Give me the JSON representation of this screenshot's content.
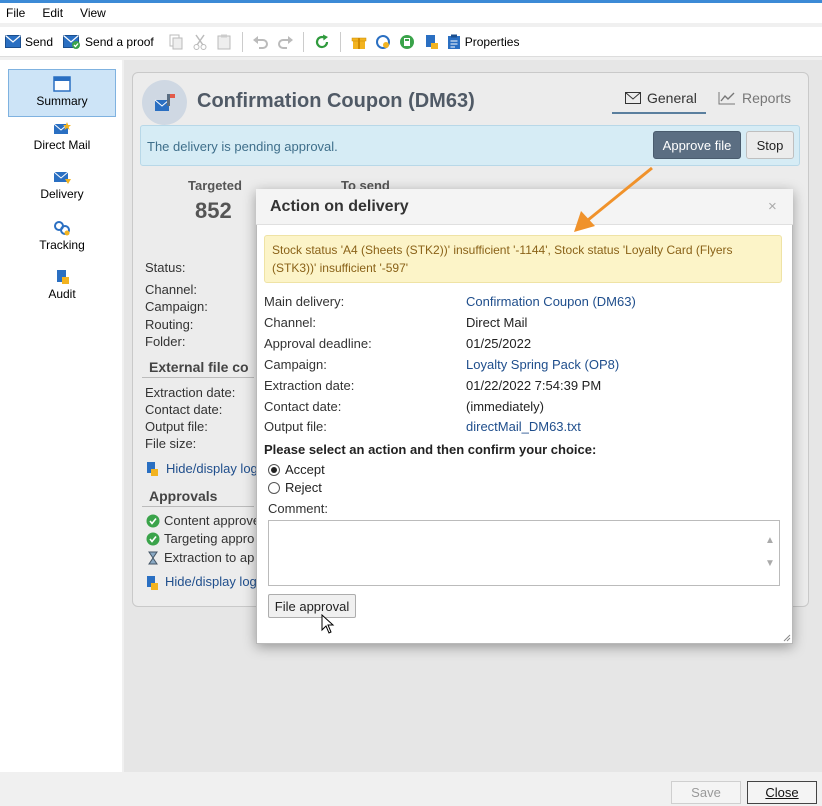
{
  "menu": {
    "items": [
      "File",
      "Edit",
      "View"
    ]
  },
  "toolbar": {
    "send_label": "Send",
    "send_proof_label": "Send a proof",
    "properties_label": "Properties"
  },
  "nav": {
    "items": [
      {
        "label": "Summary",
        "icon": "summary-icon"
      },
      {
        "label": "Direct Mail",
        "icon": "direct-mail-icon"
      },
      {
        "label": "Delivery",
        "icon": "delivery-icon"
      },
      {
        "label": "Tracking",
        "icon": "tracking-icon"
      },
      {
        "label": "Audit",
        "icon": "audit-icon"
      }
    ]
  },
  "header": {
    "title": "Confirmation Coupon (DM63)",
    "tabs": [
      {
        "label": "General"
      },
      {
        "label": "Reports"
      }
    ]
  },
  "status_bar": {
    "message": "The delivery is pending approval.",
    "approve_label": "Approve file",
    "stop_label": "Stop"
  },
  "stats": {
    "targeted_label": "Targeted",
    "targeted_value": "852",
    "to_send_label": "To send"
  },
  "summary": {
    "status_label": "Status:",
    "channel_label": "Channel:",
    "campaign_label": "Campaign:",
    "routing_label": "Routing:",
    "folder_label": "Folder:",
    "external_section": "External file co",
    "extraction_label": "Extraction date:",
    "contact_label": "Contact date:",
    "output_label": "Output file:",
    "filesize_label": "File size:",
    "hide_log_1": "Hide/display log",
    "approvals_section": "Approvals",
    "approvals": [
      "Content approve",
      "Targeting appro",
      "Extraction to ap"
    ],
    "hide_log_2": "Hide/display log"
  },
  "dialog": {
    "title": "Action on delivery",
    "close": "×",
    "warning": "Stock status 'A4 (Sheets (STK2))' insufficient '-1144', Stock status 'Loyalty Card (Flyers (STK3))' insufficient '-597'",
    "rows": [
      {
        "label": "Main delivery:",
        "value": "Confirmation Coupon (DM63)"
      },
      {
        "label": "Channel:",
        "value": "Direct Mail"
      },
      {
        "label": "Approval deadline:",
        "value": "01/25/2022"
      },
      {
        "label": "Campaign:",
        "value": "Loyalty Spring Pack (OP8)"
      },
      {
        "label": "Extraction date:",
        "value": "01/22/2022 7:54:39 PM"
      },
      {
        "label": "Contact date:",
        "value": "(immediately)"
      },
      {
        "label": "Output file:",
        "value": "directMail_DM63.txt"
      }
    ],
    "prompt": "Please select an action and then confirm your choice:",
    "accept_label": "Accept",
    "reject_label": "Reject",
    "selected_action": "Accept",
    "comment_label": "Comment:",
    "comment_value": "",
    "file_approval_label": "File approval"
  },
  "footer": {
    "save_label": "Save",
    "close_label": "Close"
  },
  "colors": {
    "accent": "#5b6e82",
    "info_bg": "#d6ecf5",
    "warning_bg": "#fcf4c8",
    "warning_text": "#8a6218",
    "link": "#1f4e8c",
    "arrow": "#f0922b"
  }
}
